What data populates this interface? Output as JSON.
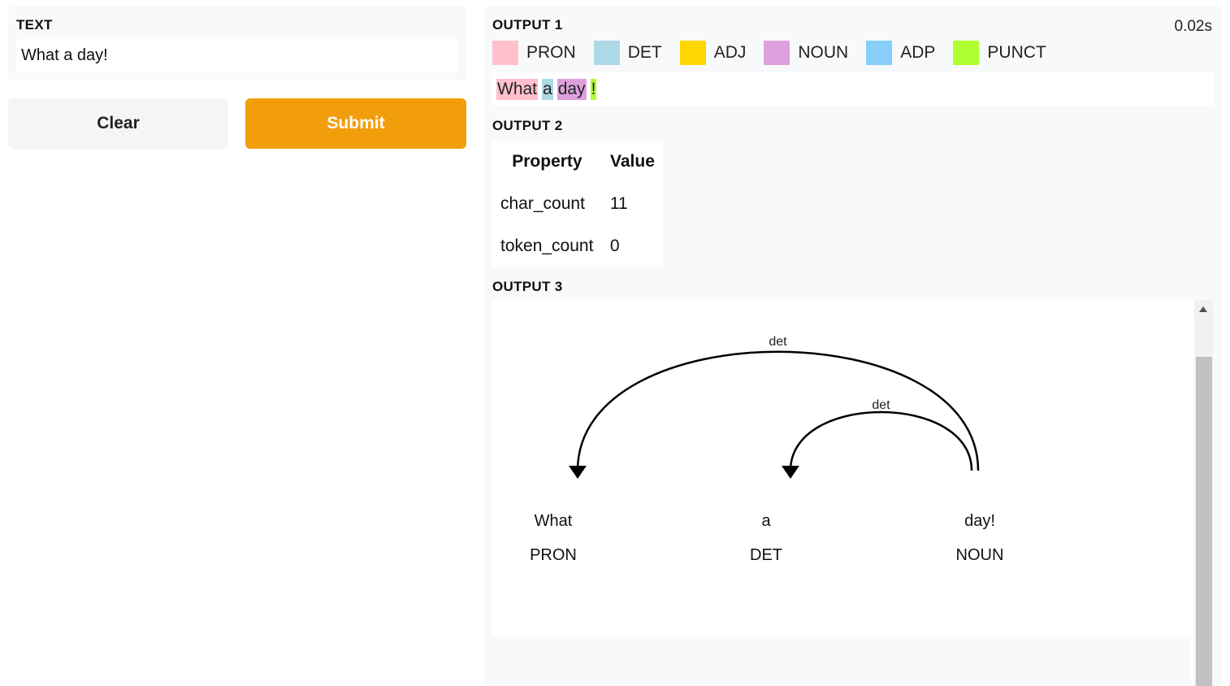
{
  "input": {
    "label": "TEXT",
    "value": "What a day!"
  },
  "buttons": {
    "clear": "Clear",
    "submit": "Submit"
  },
  "output1": {
    "label": "OUTPUT 1",
    "timer": "0.02s",
    "legend": [
      {
        "label": "PRON",
        "color": "#ffc0cb"
      },
      {
        "label": "DET",
        "color": "#add8e6"
      },
      {
        "label": "ADJ",
        "color": "#ffd700"
      },
      {
        "label": "NOUN",
        "color": "#dda0dd"
      },
      {
        "label": "ADP",
        "color": "#87cefa"
      },
      {
        "label": "PUNCT",
        "color": "#adff2f"
      }
    ],
    "tokens": [
      {
        "text": "What",
        "color": "#ffc0cb"
      },
      {
        "text": "a",
        "color": "#add8e6"
      },
      {
        "text": "day",
        "color": "#dda0dd"
      },
      {
        "text": "!",
        "color": "#adff2f"
      }
    ]
  },
  "output2": {
    "label": "OUTPUT 2",
    "headers": [
      "Property",
      "Value"
    ],
    "rows": [
      [
        "char_count",
        "11"
      ],
      [
        "token_count",
        "0"
      ]
    ]
  },
  "output3": {
    "label": "OUTPUT 3",
    "words": [
      {
        "text": "What",
        "tag": "PRON"
      },
      {
        "text": "a",
        "tag": "DET"
      },
      {
        "text": "day!",
        "tag": "NOUN"
      }
    ],
    "arcs": [
      {
        "label": "det",
        "from": 2,
        "to": 0
      },
      {
        "label": "det",
        "from": 2,
        "to": 1
      }
    ]
  }
}
